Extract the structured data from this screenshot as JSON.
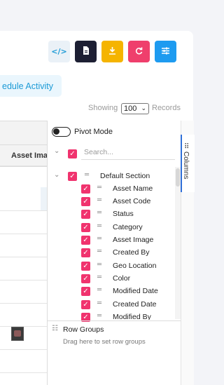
{
  "toolbar": {
    "buttons": [
      {
        "name": "code-button",
        "icon": "code-icon",
        "glyph": "</>",
        "color": "#eaf1f7",
        "fg": "#1b9ad6"
      },
      {
        "name": "export-file-button",
        "icon": "file-icon",
        "glyph": "▮",
        "color": "#1d1f33",
        "fg": "#ffffff"
      },
      {
        "name": "download-button",
        "icon": "download-icon",
        "glyph": "⤓",
        "color": "#f5b400",
        "fg": "#ffffff"
      },
      {
        "name": "refresh-button",
        "icon": "refresh-icon",
        "glyph": "⟳",
        "color": "#ef3f6c",
        "fg": "#ffffff"
      },
      {
        "name": "settings-button",
        "icon": "sliders-icon",
        "glyph": "☰",
        "color": "#1e9bf0",
        "fg": "#ffffff"
      }
    ]
  },
  "schedule": {
    "label": "edule Activity"
  },
  "records": {
    "showing_label": "Showing",
    "selected": "100",
    "records_label": "Records"
  },
  "grid": {
    "column_header": "Asset Imag",
    "rows": 9,
    "thumb_icon": "asset-thumbnail"
  },
  "panel": {
    "pivot_label": "Pivot Mode",
    "search_placeholder": "Search...",
    "section_label": "Default Section",
    "columns": [
      "Asset Name",
      "Asset Code",
      "Status",
      "Category",
      "Asset Image",
      "Created By",
      "Geo Location",
      "Color",
      "Modified Date",
      "Created Date",
      "Modified By"
    ],
    "row_groups_title": "Row Groups",
    "row_groups_hint": "Drag here to set row groups",
    "side_tab_label": "Columns"
  },
  "colors": {
    "checkbox": "#f0336e",
    "accent": "#2f6fd8"
  }
}
